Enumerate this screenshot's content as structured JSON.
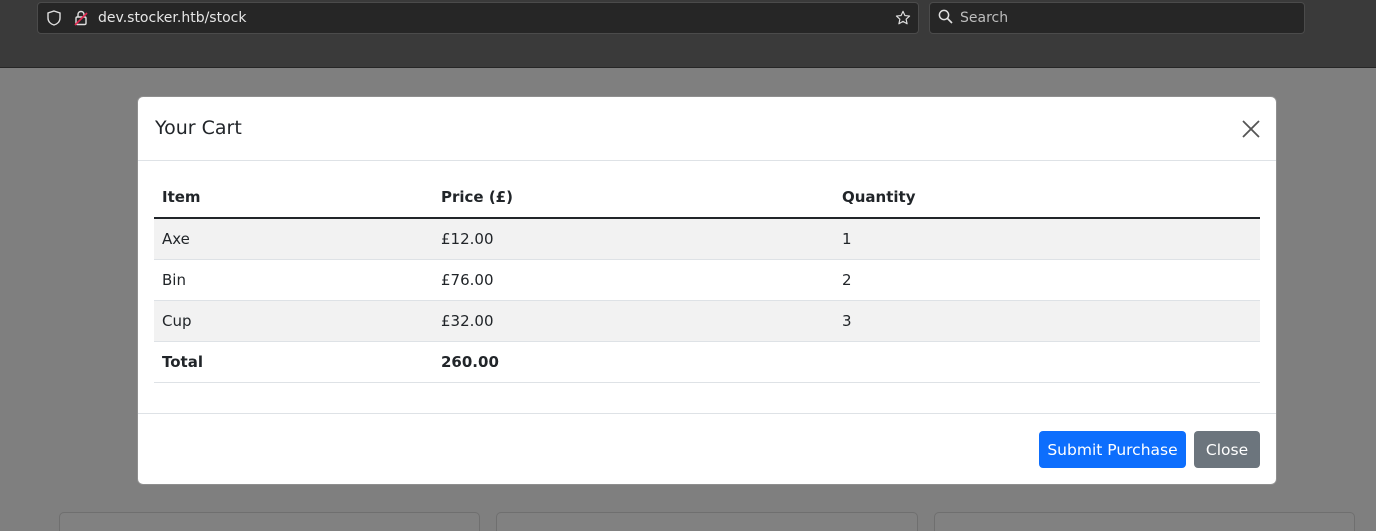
{
  "browser": {
    "url": "dev.stocker.htb/stock",
    "search_placeholder": "Search"
  },
  "modal": {
    "title": "Your Cart",
    "table": {
      "headers": [
        "Item",
        "Price (£)",
        "Quantity"
      ],
      "rows": [
        [
          "Axe",
          "£12.00",
          "1"
        ],
        [
          "Bin",
          "£76.00",
          "2"
        ],
        [
          "Cup",
          "£32.00",
          "3"
        ]
      ],
      "total_label": "Total",
      "total_value": "260.00"
    },
    "submit_label": "Submit Purchase",
    "close_label": "Close"
  },
  "colors": {
    "primary": "#0d6efd",
    "secondary": "#6c757d"
  }
}
